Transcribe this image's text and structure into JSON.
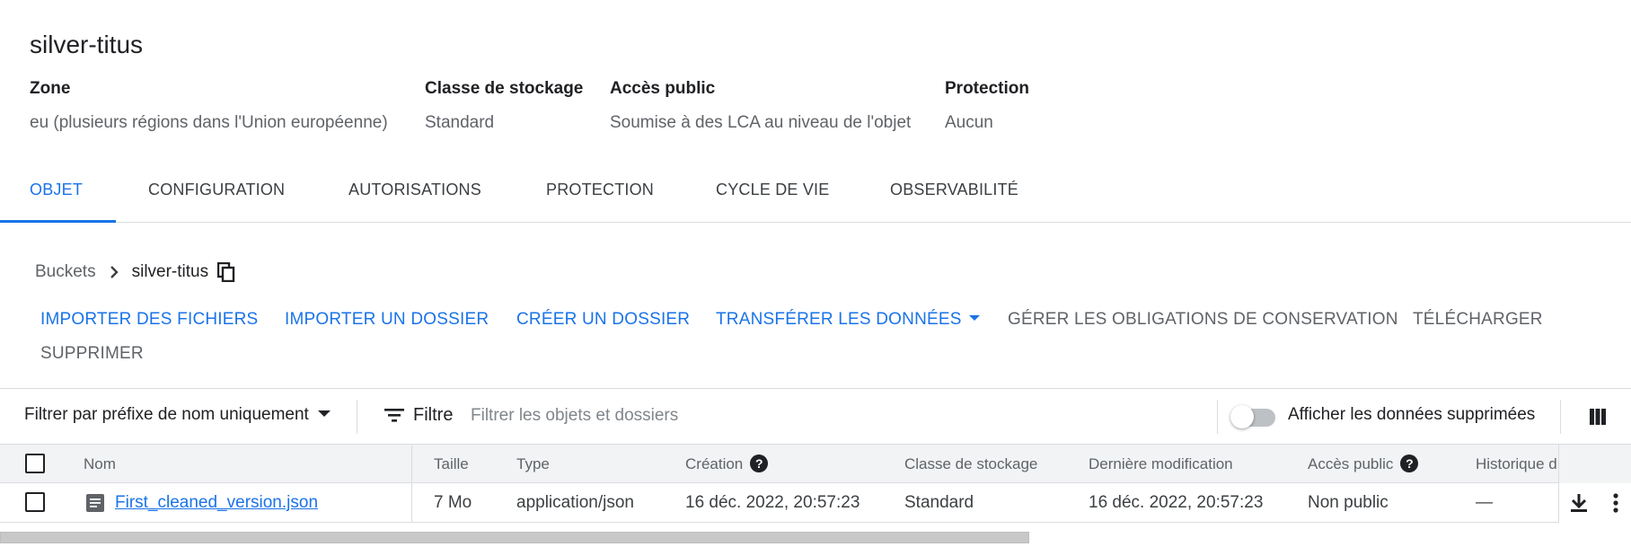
{
  "bucket": {
    "title": "silver-titus",
    "meta": [
      {
        "label": "Zone",
        "value": "eu (plusieurs régions dans l'Union européenne)"
      },
      {
        "label": "Classe de stockage",
        "value": "Standard"
      },
      {
        "label": "Accès public",
        "value": "Soumise à des LCA au niveau de l'objet"
      },
      {
        "label": "Protection",
        "value": "Aucun"
      }
    ]
  },
  "tabs": [
    {
      "label": "OBJET",
      "active": true
    },
    {
      "label": "CONFIGURATION"
    },
    {
      "label": "AUTORISATIONS"
    },
    {
      "label": "PROTECTION"
    },
    {
      "label": "CYCLE DE VIE"
    },
    {
      "label": "OBSERVABILITÉ"
    }
  ],
  "breadcrumb": {
    "root": "Buckets",
    "current": "silver-titus"
  },
  "actions": {
    "upload_files": "IMPORTER DES FICHIERS",
    "upload_folder": "IMPORTER UN DOSSIER",
    "create_folder": "CRÉER UN DOSSIER",
    "transfer_data": "TRANSFÉRER LES DONNÉES",
    "manage_holds": "GÉRER LES OBLIGATIONS DE CONSERVATION",
    "download": "TÉLÉCHARGER",
    "delete": "SUPPRIMER"
  },
  "filterbar": {
    "prefix_filter": "Filtrer par préfixe de nom uniquement",
    "filter_label": "Filtre",
    "filter_placeholder": "Filtrer les objets et dossiers",
    "show_deleted_label": "Afficher les données supprimées",
    "show_deleted_on": false
  },
  "table": {
    "columns": {
      "name": "Nom",
      "size": "Taille",
      "type": "Type",
      "created": "Création",
      "storage_class": "Classe de stockage",
      "modified": "Dernière modification",
      "public_access": "Accès public",
      "history": "Historique d"
    },
    "rows": [
      {
        "name": "First_cleaned_version.json",
        "size": "7 Mo",
        "type": "application/json",
        "created": "16 déc. 2022, 20:57:23",
        "storage_class": "Standard",
        "modified": "16 déc. 2022, 20:57:23",
        "public_access": "Non public",
        "history": "—"
      }
    ]
  },
  "colors": {
    "accent": "#1a73e8",
    "text": "#202124",
    "muted": "#5f6368",
    "divider": "#dadce0"
  }
}
